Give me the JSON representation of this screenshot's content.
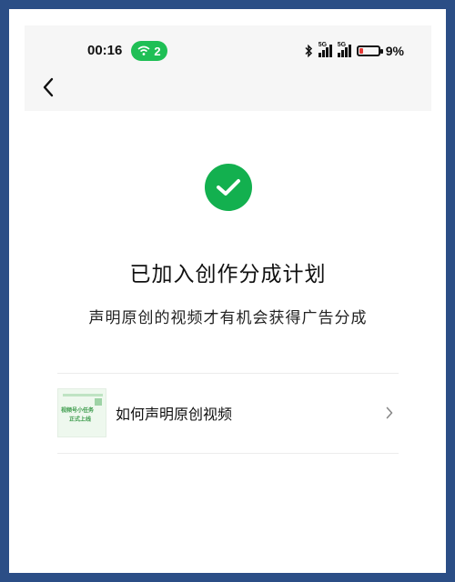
{
  "status_bar": {
    "time": "00:16",
    "wifi_count": "2",
    "network_label_1": "5G",
    "network_label_2": "5G",
    "battery_percent": "9%",
    "battery_level": 0.09
  },
  "header": {
    "back_icon": "chevron-left-icon"
  },
  "result": {
    "icon": "check-icon",
    "accent_color": "#13b04f",
    "title": "已加入创作分成计划",
    "subtitle": "声明原创的视频才有机会获得广告分成"
  },
  "list": {
    "items": [
      {
        "label": "如何声明原创视频",
        "thumb_line_1": "视频号小任务",
        "thumb_line_2": "正式上线",
        "chevron_icon": "chevron-right-icon"
      }
    ]
  },
  "colors": {
    "frame": "#2b4e86",
    "wifi_badge": "#1fbf55",
    "battery_low": "#e53935"
  }
}
